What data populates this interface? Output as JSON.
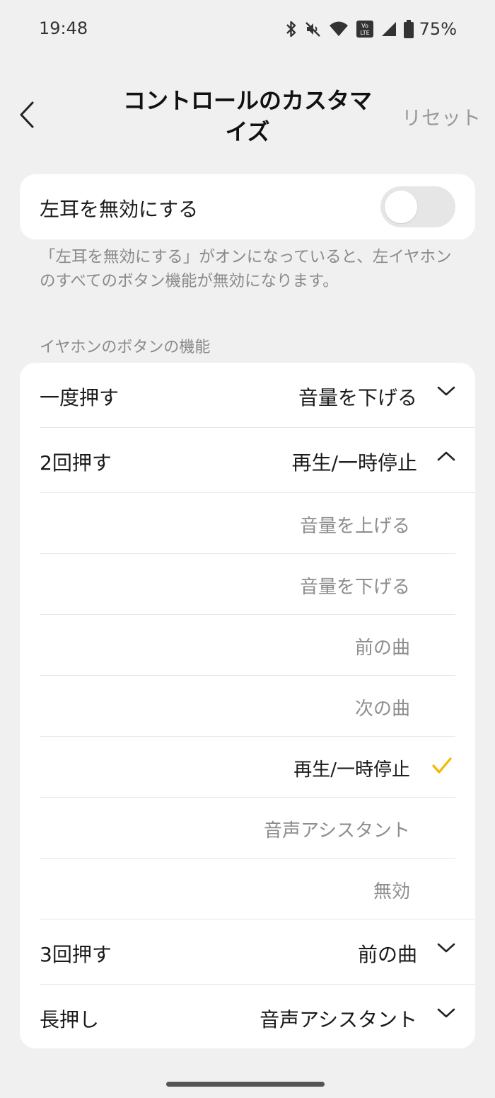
{
  "status_bar": {
    "time": "19:48",
    "icons": [
      "bluetooth-icon",
      "mute-icon",
      "wifi-icon",
      "volte-icon",
      "signal-icon",
      "battery-icon"
    ],
    "volte_text_top": "Vo",
    "volte_text_bottom": "LTE",
    "battery": "75%"
  },
  "header": {
    "back_icon": "chevron-left-icon",
    "title_line1": "コントロールのカスタマ",
    "title_line2": "イズ",
    "reset_label": "リセット"
  },
  "disable_left": {
    "label": "左耳を無効にする",
    "toggle_on": false,
    "description": "「左耳を無効にする」がオンになっていると、左イヤホンのすべてのボタン機能が無効になります。"
  },
  "button_functions": {
    "section_title": "イヤホンのボタンの機能",
    "rows": [
      {
        "label": "一度押す",
        "value": "音量を下げる",
        "expanded": false
      },
      {
        "label": "2回押す",
        "value": "再生/一時停止",
        "expanded": true
      },
      {
        "label": "3回押す",
        "value": "前の曲",
        "expanded": false
      },
      {
        "label": "長押し",
        "value": "音声アシスタント",
        "expanded": false
      }
    ],
    "options": [
      "音量を上げる",
      "音量を下げる",
      "前の曲",
      "次の曲",
      "再生/一時停止",
      "音声アシスタント",
      "無効"
    ],
    "selected_option": "再生/一時停止"
  },
  "colors": {
    "background": "#f0f0f0",
    "card": "#ffffff",
    "accent_check": "#f5b800",
    "secondary_text": "#8a8a8a"
  }
}
